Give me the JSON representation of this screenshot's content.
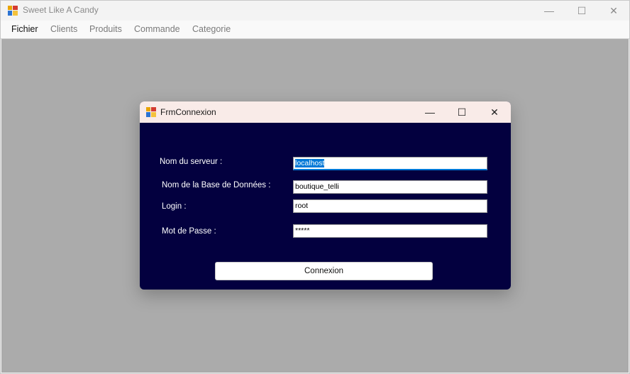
{
  "window": {
    "title": "Sweet Like A Candy",
    "controls": {
      "minimize": "—",
      "maximize": "☐",
      "close": "✕"
    }
  },
  "menu": {
    "items": [
      "Fichier",
      "Clients",
      "Produits",
      "Commande",
      "Categorie"
    ]
  },
  "dialog": {
    "title": "FrmConnexion",
    "controls": {
      "minimize": "—",
      "maximize": "☐",
      "close": "✕"
    },
    "fields": {
      "server": {
        "label": "Nom du serveur :",
        "value_selected": "localhost"
      },
      "database": {
        "label": "Nom de la Base de Données :",
        "value": "boutique_telli"
      },
      "login": {
        "label": "Login :",
        "value": "root"
      },
      "password": {
        "label": "Mot de Passe :",
        "value": "*****"
      }
    },
    "button_label": "Connexion"
  },
  "colors": {
    "dialog_background": "#03003f",
    "dialog_titlebar": "#f9ebe8",
    "mdi_background": "#ababab",
    "selection": "#0078d7"
  },
  "icons": {
    "app": "window-app-icon",
    "dialog": "window-app-icon"
  }
}
